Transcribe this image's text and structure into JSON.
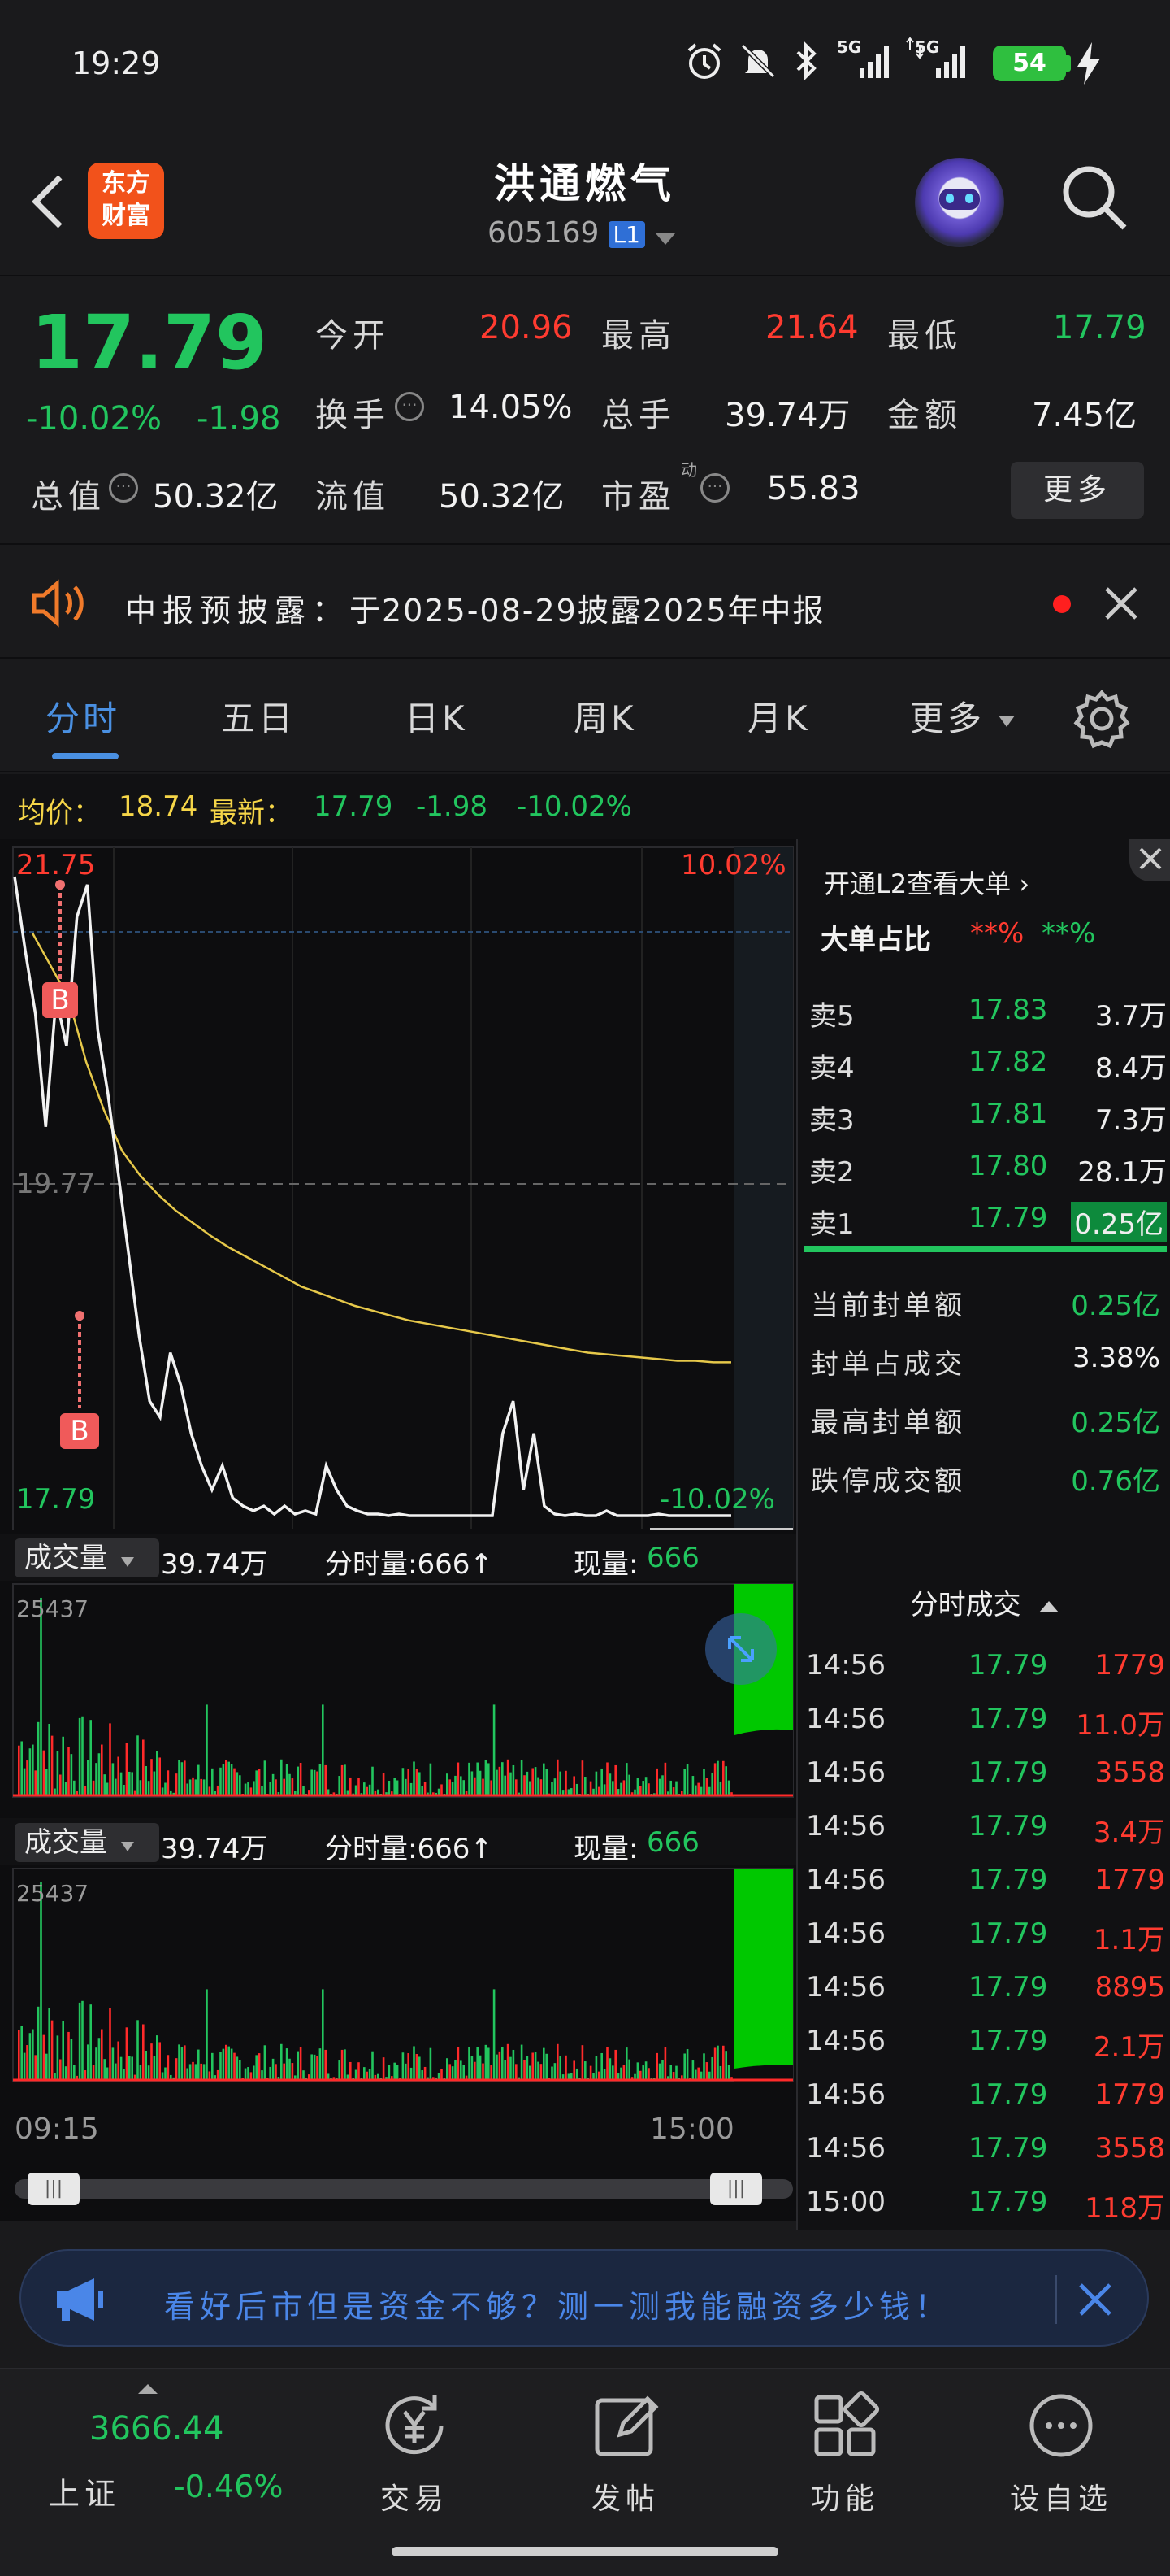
{
  "status_bar": {
    "time": "19:29",
    "battery": "54",
    "network1": "5G",
    "network2": "5G"
  },
  "header": {
    "logo_line1": "东方",
    "logo_line2": "财富",
    "stock_name": "洪通燃气",
    "stock_code": "605169",
    "level_badge": "L1"
  },
  "quote": {
    "price": "17.79",
    "change_pct": "-10.02%",
    "change": "-1.98",
    "open_label": "今开",
    "open": "20.96",
    "high_label": "最高",
    "high": "21.64",
    "low_label": "最低",
    "low": "17.79",
    "turnover_label": "换手",
    "turnover": "14.05%",
    "total_hand_label": "总手",
    "total_hand": "39.74万",
    "amount_label": "金额",
    "amount": "7.45亿",
    "total_value_label": "总值",
    "total_value": "50.32亿",
    "float_value_label": "流值",
    "float_value": "50.32亿",
    "pe_label": "市盈",
    "pe_sub": "动",
    "pe": "55.83",
    "more_label": "更多"
  },
  "notice": {
    "text_prefix": "中报预披露：",
    "text_main": "于2025-08-29披露2025年中报"
  },
  "tabs": [
    {
      "label": "分时",
      "active": true
    },
    {
      "label": "五日"
    },
    {
      "label": "日K"
    },
    {
      "label": "周K"
    },
    {
      "label": "月K"
    },
    {
      "label": "更多"
    }
  ],
  "avg_bar": {
    "avg_label": "均价：",
    "avg": "18.74",
    "latest_label": "最新：",
    "latest": "17.79",
    "chg": "-1.98",
    "chg_pct": "-10.02%"
  },
  "chart_data": {
    "type": "line",
    "x_start": "09:15",
    "x_end": "15:00",
    "y_top": "21.75",
    "y_mid": "19.77",
    "y_bottom": "17.79",
    "pct_top": "10.02%",
    "pct_bottom": "-10.02%",
    "ylim": [
      17.79,
      21.75
    ],
    "price_series": [
      21.75,
      21.3,
      20.9,
      20.2,
      21.0,
      20.7,
      21.5,
      21.7,
      20.8,
      20.4,
      19.9,
      19.4,
      18.9,
      18.5,
      18.4,
      18.8,
      18.6,
      18.3,
      18.1,
      17.95,
      18.1,
      17.9,
      17.85,
      17.82,
      17.85,
      17.8,
      17.85,
      17.8,
      17.82,
      17.8,
      18.1,
      17.95,
      17.85,
      17.82,
      17.8,
      17.8,
      17.79,
      17.8,
      17.79,
      17.79,
      17.79,
      17.79,
      17.79,
      17.79,
      17.79,
      17.79,
      17.79,
      18.3,
      18.5,
      17.95,
      18.3,
      17.85,
      17.8,
      17.79,
      17.8,
      17.79,
      17.79,
      17.82,
      17.79,
      17.79,
      17.79,
      17.79,
      17.8,
      17.79,
      17.79,
      17.79,
      17.79,
      17.79,
      17.79,
      17.79
    ],
    "avg_series": [
      21.4,
      21.2,
      21.0,
      20.6,
      20.3,
      20.05,
      19.9,
      19.78,
      19.68,
      19.6,
      19.52,
      19.45,
      19.39,
      19.33,
      19.27,
      19.21,
      19.17,
      19.13,
      19.09,
      19.06,
      19.03,
      19.0,
      18.98,
      18.96,
      18.94,
      18.92,
      18.9,
      18.88,
      18.86,
      18.84,
      18.82,
      18.8,
      18.79,
      18.78,
      18.77,
      18.76,
      18.75,
      18.75,
      18.74,
      18.74
    ],
    "volume_label": "成交量",
    "volume_total": "39.74万",
    "minute_vol_label": "分时量:666↑",
    "current_label": "现量:",
    "current": "666",
    "vol_max": "25437"
  },
  "l2": {
    "open_label": "开通L2查看大单",
    "big_ratio_label": "大单占比",
    "big_ratio_red": "**%",
    "big_ratio_green": "**%"
  },
  "order_book": {
    "sells": [
      {
        "label": "卖5",
        "price": "17.83",
        "vol": "3.7万"
      },
      {
        "label": "卖4",
        "price": "17.82",
        "vol": "8.4万"
      },
      {
        "label": "卖3",
        "price": "17.81",
        "vol": "7.3万"
      },
      {
        "label": "卖2",
        "price": "17.80",
        "vol": "28.1万"
      },
      {
        "label": "卖1",
        "price": "17.79",
        "vol": "0.25亿"
      }
    ],
    "seal": [
      {
        "label": "当前封单额",
        "value": "0.25亿",
        "color": "green"
      },
      {
        "label": "封单占成交",
        "value": "3.38%",
        "color": "white"
      },
      {
        "label": "最高封单额",
        "value": "0.25亿",
        "color": "green"
      },
      {
        "label": "跌停成交额",
        "value": "0.76亿",
        "color": "green"
      }
    ]
  },
  "trades": {
    "title": "分时成交",
    "rows": [
      {
        "time": "14:56",
        "price": "17.79",
        "vol": "1779"
      },
      {
        "time": "14:56",
        "price": "17.79",
        "vol": "11.0万"
      },
      {
        "time": "14:56",
        "price": "17.79",
        "vol": "3558"
      },
      {
        "time": "14:56",
        "price": "17.79",
        "vol": "3.4万"
      },
      {
        "time": "14:56",
        "price": "17.79",
        "vol": "1779"
      },
      {
        "time": "14:56",
        "price": "17.79",
        "vol": "1.1万"
      },
      {
        "time": "14:56",
        "price": "17.79",
        "vol": "8895"
      },
      {
        "time": "14:56",
        "price": "17.79",
        "vol": "2.1万"
      },
      {
        "time": "14:56",
        "price": "17.79",
        "vol": "1779"
      },
      {
        "time": "14:56",
        "price": "17.79",
        "vol": "3558"
      },
      {
        "time": "15:00",
        "price": "17.79",
        "vol": "118万"
      }
    ]
  },
  "ad": {
    "text": "看好后市但是资金不够？测一测我能融资多少钱！"
  },
  "bottom_nav": {
    "index_value": "3666.44",
    "index_name": "上证",
    "index_chg": "-0.46%",
    "trade": "交易",
    "post": "发帖",
    "func": "功能",
    "watch": "设自选"
  }
}
